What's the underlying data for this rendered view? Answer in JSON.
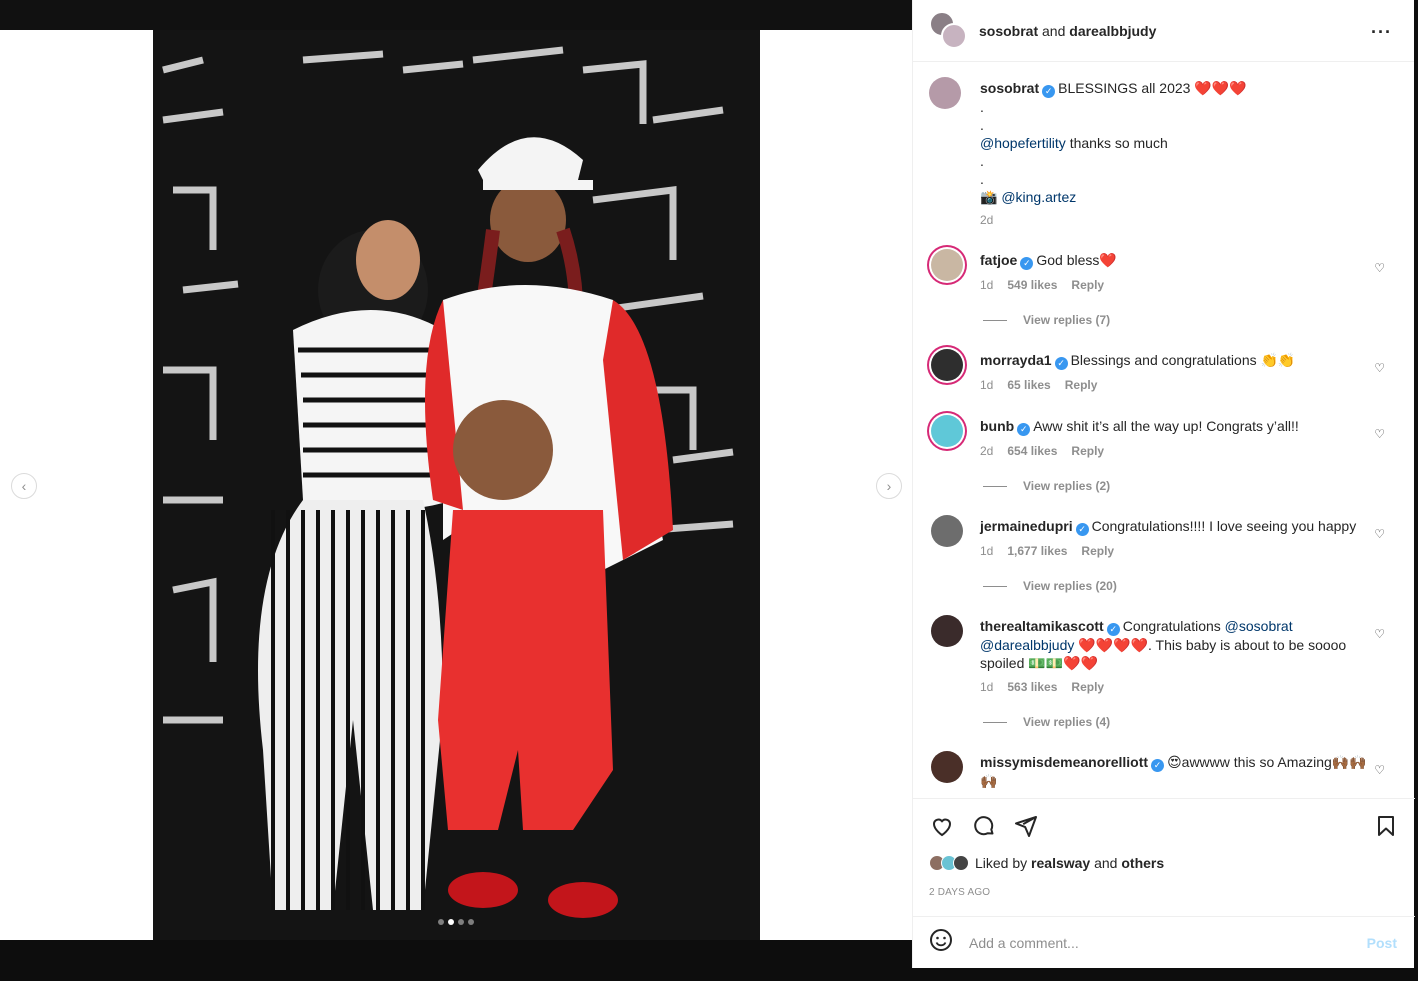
{
  "post": {
    "header": {
      "user1": "sosobrat",
      "joiner": "and",
      "user2": "darealbbjudy"
    },
    "caption": {
      "username": "sosobrat",
      "line1": "BLESSINGS all 2023 ❤️❤️❤️",
      "dot1": ".",
      "dot2": ".",
      "mention1": "@hopefertility",
      "line3": " thanks so much",
      "dot3": ".",
      "dot4": ".",
      "camera": "📸",
      "mention2": "@king.artez",
      "time": "2d"
    },
    "comments": [
      {
        "username": "fatjoe",
        "text": "God bless❤️",
        "time": "1d",
        "likes": "549 likes",
        "reply": "Reply",
        "view_replies": "View replies (7)"
      },
      {
        "username": "morrayda1",
        "text": "Blessings and congratulations 👏👏",
        "time": "1d",
        "likes": "65 likes",
        "reply": "Reply"
      },
      {
        "username": "bunb",
        "text": "Aww shit it’s all the way up! Congrats y’all!!",
        "time": "2d",
        "likes": "654 likes",
        "reply": "Reply",
        "view_replies": "View replies (2)"
      },
      {
        "username": "jermainedupri",
        "text": "Congratulations!!!! I love seeing you happy",
        "time": "1d",
        "likes": "1,677 likes",
        "reply": "Reply",
        "view_replies": "View replies (20)"
      },
      {
        "username": "therealtamikascott",
        "text_a": "Congratulations ",
        "mention_a": "@sosobrat",
        "mention_b": "@darealbbjudy",
        "text_b": " ❤️❤️❤️❤️. This baby is about to be soooo spoiled 💵💵❤️❤️",
        "time": "1d",
        "likes": "563 likes",
        "reply": "Reply",
        "view_replies": "View replies (4)"
      },
      {
        "username": "missymisdemeanorelliott",
        "text": "😍awwww this so Amazing🙌🏾🙌🏾🙌🏾"
      }
    ],
    "liked_by": {
      "prefix": "Liked by ",
      "user": "realsway",
      "joiner": " and ",
      "others": "others"
    },
    "date": "2 DAYS AGO",
    "add_comment": {
      "placeholder": "Add a comment...",
      "post": "Post"
    }
  },
  "icons": {
    "more": "more-options-icon",
    "like": "heart-icon",
    "comment": "comment-icon",
    "share": "share-icon",
    "save": "bookmark-icon",
    "emoji": "emoji-icon",
    "prev": "chevron-left-icon",
    "next": "chevron-right-icon"
  },
  "carousel": {
    "count": 4,
    "active": 2
  },
  "colors": {
    "verified": "#3897f0",
    "mention": "#00376b",
    "muted": "#8e8e8e",
    "post_disabled": "#b2dffc"
  }
}
